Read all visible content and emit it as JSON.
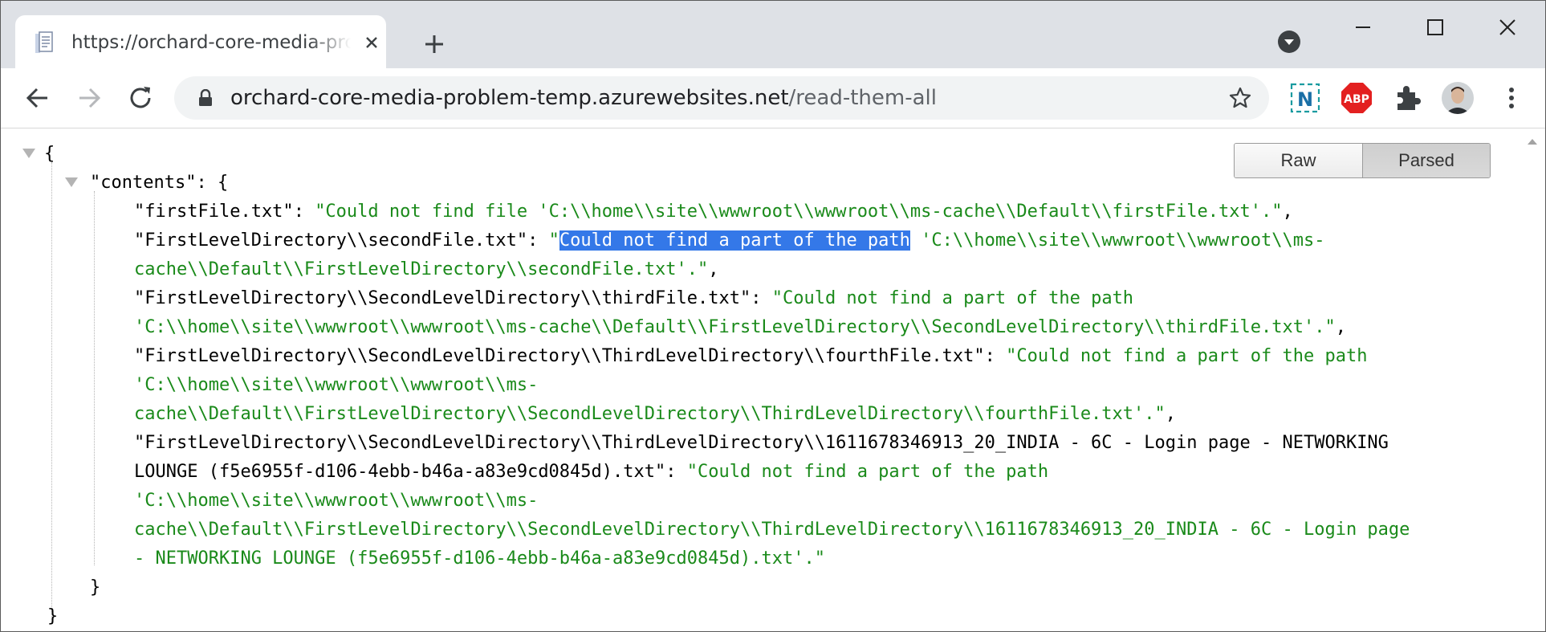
{
  "browser": {
    "tab_title": "https://orchard-core-media-problem-temp.azurewebsites.net/read-them-all",
    "url_host": "orchard-core-media-problem-temp.azurewebsites.net",
    "url_path": "/read-them-all",
    "extensions": [
      "n-extension-icon",
      "adblock-plus-icon",
      "extensions-puzzle-icon",
      "profile-avatar"
    ],
    "adblock_label": "ABP",
    "n_label": "N"
  },
  "viewer": {
    "raw_label": "Raw",
    "parsed_label": "Parsed",
    "selected_mode": "Parsed",
    "lines": {
      "l1": "{",
      "l2_key": "\"contents\"",
      "l2_rest": ": {",
      "l3_key": "\"firstFile.txt\"",
      "l3_colon": ": ",
      "l3_val": "\"Could not find file 'C:\\\\home\\\\site\\\\wwwroot\\\\wwwroot\\\\ms-cache\\\\Default\\\\firstFile.txt'.\"",
      "l3_comma": ",",
      "l4_key": "\"FirstLevelDirectory\\\\secondFile.txt\"",
      "l4_colon": ": ",
      "l4_quote": "\"",
      "l4_selected": "Could not find a part of the path",
      "l4_val": " 'C:\\\\home\\\\site\\\\wwwroot\\\\wwwroot\\\\ms-",
      "l5_val": "cache\\\\Default\\\\FirstLevelDirectory\\\\secondFile.txt'.\"",
      "l5_comma": ",",
      "l6_key": "\"FirstLevelDirectory\\\\SecondLevelDirectory\\\\thirdFile.txt\"",
      "l6_colon": ": ",
      "l6_val": "\"Could not find a part of the path",
      "l7_val": "'C:\\\\home\\\\site\\\\wwwroot\\\\wwwroot\\\\ms-cache\\\\Default\\\\FirstLevelDirectory\\\\SecondLevelDirectory\\\\thirdFile.txt'.\"",
      "l7_comma": ",",
      "l8_key": "\"FirstLevelDirectory\\\\SecondLevelDirectory\\\\ThirdLevelDirectory\\\\fourthFile.txt\"",
      "l8_colon": ": ",
      "l8_val": "\"Could not find a part of the path",
      "l9_val": "'C:\\\\home\\\\site\\\\wwwroot\\\\wwwroot\\\\ms-",
      "l10_val": "cache\\\\Default\\\\FirstLevelDirectory\\\\SecondLevelDirectory\\\\ThirdLevelDirectory\\\\fourthFile.txt'.\"",
      "l10_comma": ",",
      "l11_key": "\"FirstLevelDirectory\\\\SecondLevelDirectory\\\\ThirdLevelDirectory\\\\1611678346913_20_INDIA - 6C - Login page - NETWORKING",
      "l12_key": "LOUNGE (f5e6955f-d106-4ebb-b46a-a83e9cd0845d).txt\"",
      "l12_colon": ": ",
      "l12_val": "\"Could not find a part of the path",
      "l13_val": "'C:\\\\home\\\\site\\\\wwwroot\\\\wwwroot\\\\ms-",
      "l14_val": "cache\\\\Default\\\\FirstLevelDirectory\\\\SecondLevelDirectory\\\\ThirdLevelDirectory\\\\1611678346913_20_INDIA - 6C - Login page",
      "l15_val": "- NETWORKING LOUNGE (f5e6955f-d106-4ebb-b46a-a83e9cd0845d).txt'.\"",
      "l16": "}",
      "l17": "}"
    }
  }
}
